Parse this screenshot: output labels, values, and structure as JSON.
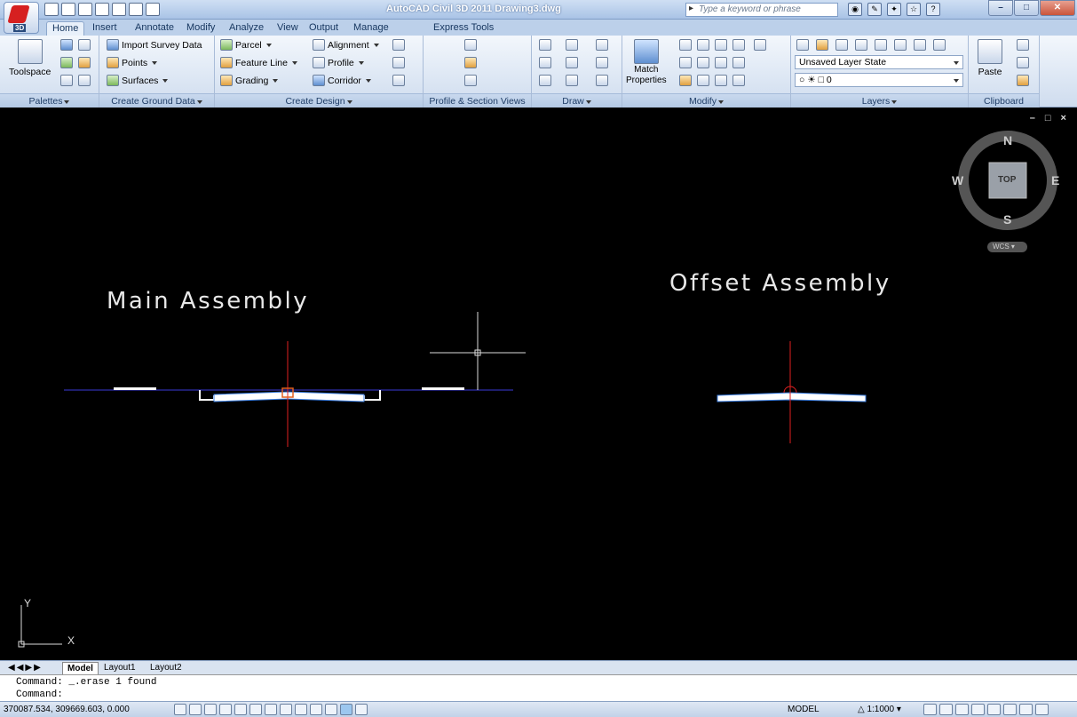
{
  "app": {
    "title": "AutoCAD Civil 3D 2011   Drawing3.dwg",
    "app_button_label": "3D",
    "search_placeholder": "Type a keyword or phrase",
    "qat_extra": "▾"
  },
  "tabs": [
    "Home",
    "Insert",
    "Annotate",
    "Modify",
    "Analyze",
    "View",
    "Output",
    "Manage",
    "Express Tools"
  ],
  "active_tab": "Home",
  "ribbon": {
    "palettes": {
      "toolspace": "Toolspace",
      "title": "Palettes"
    },
    "create_ground": {
      "import_survey": "Import Survey Data",
      "points": "Points",
      "surfaces": "Surfaces",
      "title": "Create Ground Data"
    },
    "create_design": {
      "parcel": "Parcel",
      "feature_line": "Feature Line",
      "grading": "Grading",
      "alignment": "Alignment",
      "profile": "Profile",
      "corridor": "Corridor",
      "title": "Create Design"
    },
    "profile_views": {
      "title": "Profile & Section Views"
    },
    "draw": {
      "title": "Draw"
    },
    "modify": {
      "match_line1": "Match",
      "match_line2": "Properties",
      "title": "Modify"
    },
    "layers": {
      "layer_state": "Unsaved Layer State",
      "current_layer": "0",
      "title": "Layers"
    },
    "clipboard": {
      "paste": "Paste",
      "title": "Clipboard"
    }
  },
  "viewport": {
    "main_label": "Main Assembly",
    "offset_label": "Offset Assembly",
    "viewcube": {
      "north": "N",
      "south": "S",
      "east": "E",
      "west": "W",
      "top": "TOP",
      "wcs": "WCS"
    },
    "ucs": {
      "x": "X",
      "y": "Y"
    },
    "controls": "– □ ×"
  },
  "layout_tabs": [
    "Model",
    "Layout1",
    "Layout2"
  ],
  "active_layout": "Model",
  "command": {
    "line1": "Command:  _.erase 1 found",
    "line2": "Command:"
  },
  "status": {
    "coords": "370087.534, 309669.603, 0.000",
    "model": "MODEL",
    "scale": "1:1000"
  },
  "colors": {
    "viewport_bg": "#000000",
    "baseline": "#3a3ad8",
    "marker": "#e02020",
    "assembly_fill": "#ffffff",
    "assembly_edge": "#3a7de0"
  }
}
